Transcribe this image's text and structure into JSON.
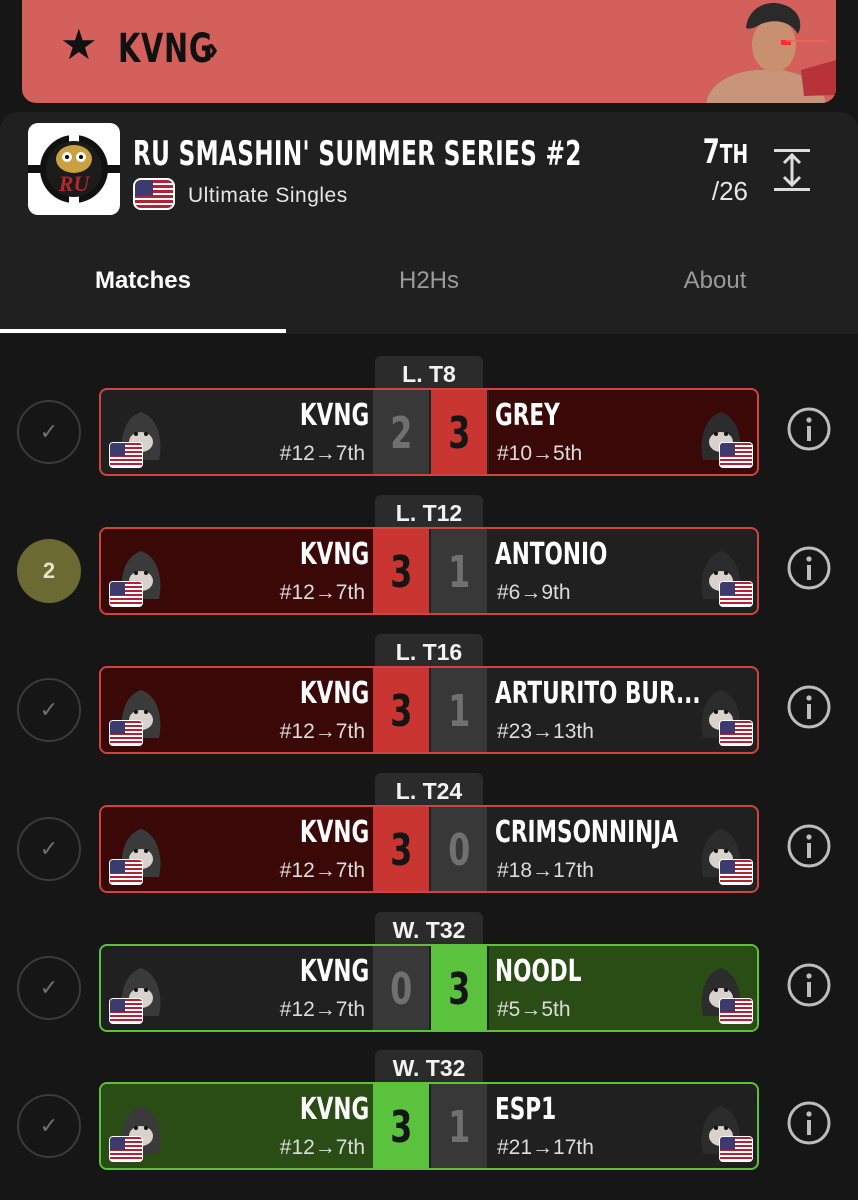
{
  "banner": {
    "player": "KVNG",
    "bg": "#d4605b"
  },
  "tournament": {
    "title": "RU SMASHIN' SUMMER SERIES #2",
    "event": "Ultimate Singles",
    "placement_num": "7",
    "placement_suffix": "TH",
    "entrants": "/26",
    "logo_text": "RU"
  },
  "tabs": [
    {
      "label": "Matches",
      "active": true
    },
    {
      "label": "H2Hs",
      "active": false
    },
    {
      "label": "About",
      "active": false
    }
  ],
  "colors": {
    "win": "#5ac23c",
    "loss": "#c93530",
    "bg": "#161616"
  },
  "matches": [
    {
      "round": "L. T8",
      "status": "check",
      "p1": "KVNG",
      "p1_seed": "#12→7th",
      "s1": "2",
      "s2": "3",
      "p2": "GREY",
      "p2_seed": "#10→5th",
      "result": "loss"
    },
    {
      "round": "L. T12",
      "status": "2",
      "p1": "KVNG",
      "p1_seed": "#12→7th",
      "s1": "3",
      "s2": "1",
      "p2": "ANTONIO",
      "p2_seed": "#6→9th",
      "result": "win-red"
    },
    {
      "round": "L. T16",
      "status": "check",
      "p1": "KVNG",
      "p1_seed": "#12→7th",
      "s1": "3",
      "s2": "1",
      "p2": "ARTURITO BUR...",
      "p2_seed": "#23→13th",
      "result": "win-red"
    },
    {
      "round": "L. T24",
      "status": "check",
      "p1": "KVNG",
      "p1_seed": "#12→7th",
      "s1": "3",
      "s2": "0",
      "p2": "CRIMSONNINJA",
      "p2_seed": "#18→17th",
      "result": "win-red"
    },
    {
      "round": "W. T32",
      "status": "check",
      "p1": "KVNG",
      "p1_seed": "#12→7th",
      "s1": "0",
      "s2": "3",
      "p2": "NOODL",
      "p2_seed": "#5→5th",
      "result": "loss-green"
    },
    {
      "round": "W. T32",
      "status": "check",
      "p1": "KVNG",
      "p1_seed": "#12→7th",
      "s1": "3",
      "s2": "1",
      "p2": "ESP1",
      "p2_seed": "#21→17th",
      "result": "win-green"
    }
  ]
}
